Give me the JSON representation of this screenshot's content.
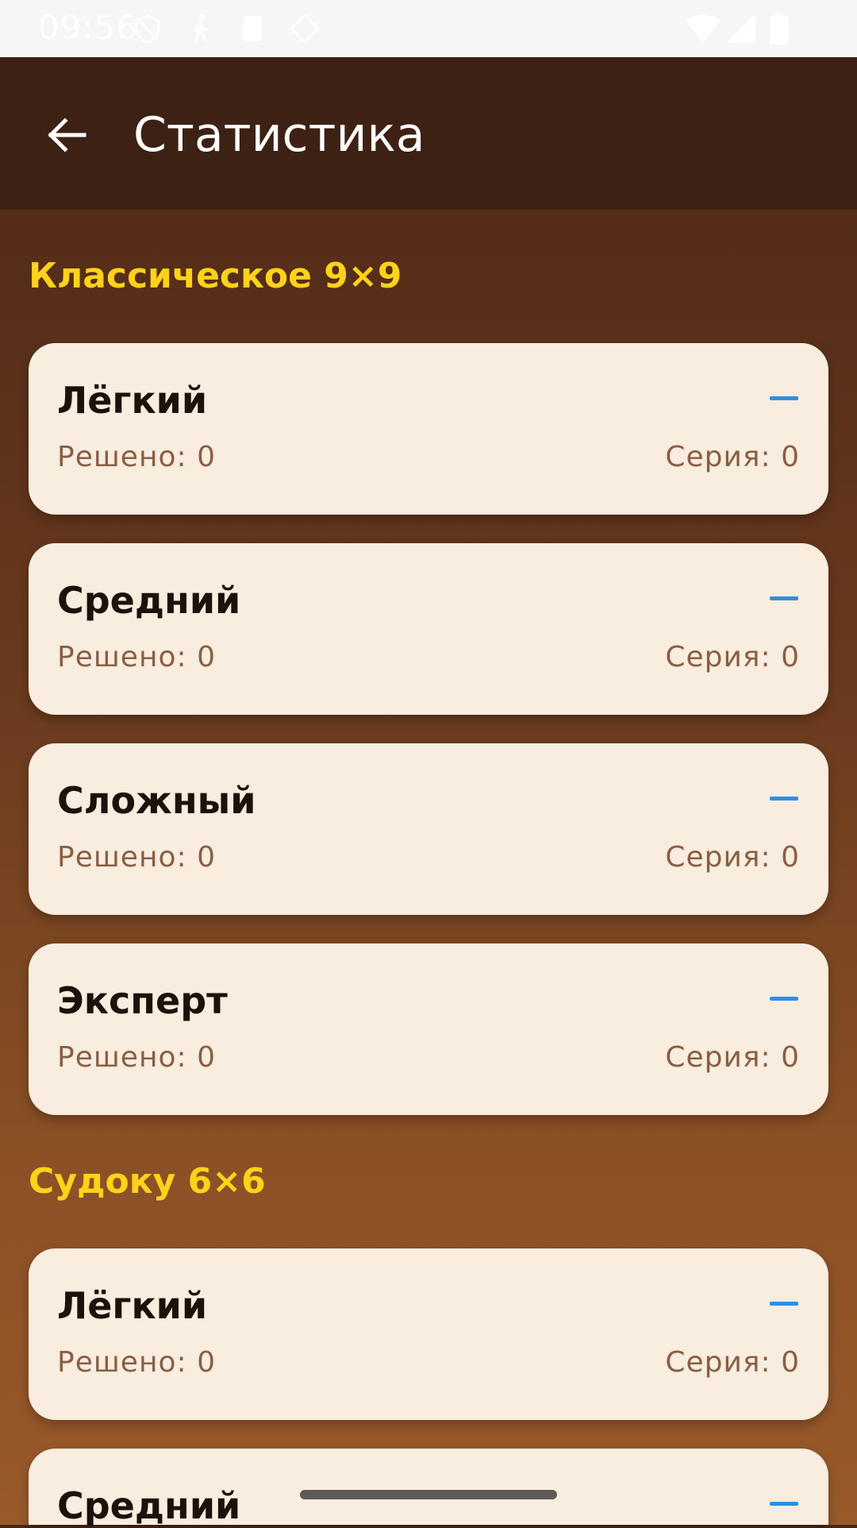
{
  "status_bar": {
    "time": "09:56",
    "icons": [
      "shield-icon",
      "walking-icon",
      "sd-card-icon",
      "location-icon",
      "wifi-icon",
      "signal-icon",
      "battery-icon"
    ]
  },
  "app_bar": {
    "title": "Статистика",
    "back_icon": "arrow-back-icon"
  },
  "colors": {
    "app_bar": "#3d2114",
    "section_title": "#ffd21a",
    "card_bg": "#f8eddf",
    "accent_dash": "#2e8ee6",
    "secondary_text": "#8a5e44"
  },
  "sections": [
    {
      "title": "Классическое 9×9",
      "cards": [
        {
          "title": "Лёгкий",
          "indicator": "–",
          "solved": "Решено: 0",
          "streak": "Серия: 0"
        },
        {
          "title": "Средний",
          "indicator": "–",
          "solved": "Решено: 0",
          "streak": "Серия: 0"
        },
        {
          "title": "Сложный",
          "indicator": "–",
          "solved": "Решено: 0",
          "streak": "Серия: 0"
        },
        {
          "title": "Эксперт",
          "indicator": "–",
          "solved": "Решено: 0",
          "streak": "Серия: 0"
        }
      ]
    },
    {
      "title": "Судоку 6×6",
      "cards": [
        {
          "title": "Лёгкий",
          "indicator": "–",
          "solved": "Решено: 0",
          "streak": "Серия: 0"
        },
        {
          "title": "Средний",
          "indicator": "–",
          "solved": "",
          "streak": ""
        }
      ]
    }
  ]
}
